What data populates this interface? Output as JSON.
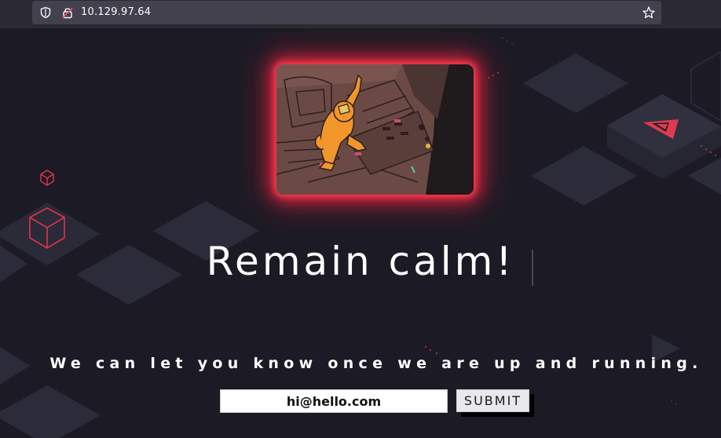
{
  "browser": {
    "url": "10.129.97.64"
  },
  "hero": {
    "heading": "Remain calm!",
    "subtext": "We can let you know once we are up and running."
  },
  "form": {
    "email_value": "hi@hello.com",
    "submit_label": "SUBMIT"
  },
  "colors": {
    "accent": "#ff3a4f",
    "page_bg": "#1c1b25",
    "tile": "#2c2c3a"
  },
  "icons": [
    "shield-icon",
    "lock-icon",
    "bookmark-star-icon",
    "cube-icon",
    "arrow-logo-icon"
  ]
}
